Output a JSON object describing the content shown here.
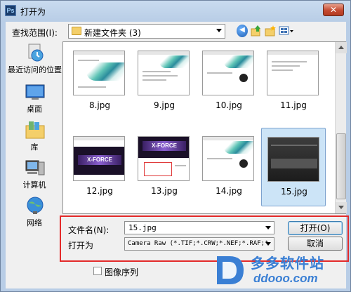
{
  "window": {
    "title": "打开为",
    "app_icon": "photoshop-icon",
    "close_icon": "close-icon",
    "close_glyph": "✕"
  },
  "lookin": {
    "label": "查找范围(I):",
    "value": "新建文件夹 (3)"
  },
  "toolbar": {
    "back_icon": "back-icon",
    "back_glyph": "◀",
    "up_icon": "up-folder-icon",
    "new_folder_icon": "new-folder-icon",
    "views_icon": "views-menu-icon"
  },
  "places": [
    {
      "label": "最近访问的位置",
      "icon": "recent-places-icon"
    },
    {
      "label": "桌面",
      "icon": "desktop-icon"
    },
    {
      "label": "库",
      "icon": "libraries-icon"
    },
    {
      "label": "计算机",
      "icon": "computer-icon"
    },
    {
      "label": "网络",
      "icon": "network-icon"
    }
  ],
  "files": [
    {
      "name": "8.jpg",
      "style": "installer-swoosh",
      "selected": false
    },
    {
      "name": "9.jpg",
      "style": "installer-form",
      "selected": false
    },
    {
      "name": "10.jpg",
      "style": "installer-disc",
      "selected": false
    },
    {
      "name": "11.jpg",
      "style": "installer-plain",
      "selected": false
    },
    {
      "name": "12.jpg",
      "style": "xforce-dark",
      "selected": false
    },
    {
      "name": "13.jpg",
      "style": "xforce-red",
      "selected": false
    },
    {
      "name": "14.jpg",
      "style": "installer-disc",
      "selected": false
    },
    {
      "name": "15.jpg",
      "style": "camera-raw",
      "selected": true
    }
  ],
  "filename": {
    "label": "文件名(N):",
    "value": "15.jpg"
  },
  "filetype": {
    "label": "打开为",
    "value": "Camera Raw (*.TIF;*.CRW;*.NEF;*.RAF;*."
  },
  "buttons": {
    "open": "打开(O)",
    "cancel": "取消"
  },
  "sequence": {
    "label": "图像序列",
    "checked": false
  },
  "watermark": {
    "title": "多多软件站",
    "url": "ddooo.com"
  },
  "colors": {
    "highlight": "#e32a2a",
    "selection": "#cce4f7",
    "watermark": "#3a7fd4"
  }
}
